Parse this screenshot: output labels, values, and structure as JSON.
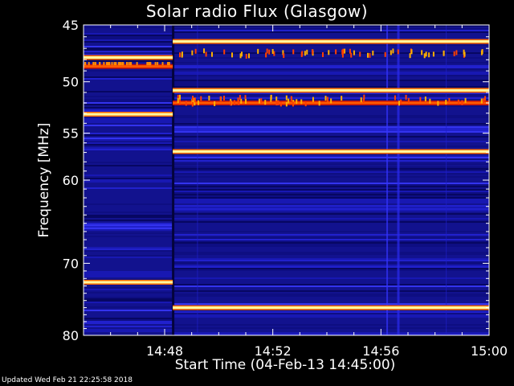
{
  "chart_data": {
    "type": "heatmap",
    "title": "Solar radio Flux (Glasgow)",
    "xlabel": "Start Time (04-Feb-13 14:45:00)",
    "ylabel": "Frequency [MHz]",
    "x_ticks": [
      "14:48",
      "14:52",
      "14:56",
      "15:00"
    ],
    "x_tick_minutes": [
      3,
      7,
      11,
      15
    ],
    "xlim_minutes": [
      0,
      15
    ],
    "y_ticks": [
      45,
      50,
      55,
      60,
      70,
      80
    ],
    "ylim": [
      45,
      80
    ],
    "y_scale": "log",
    "colormap": [
      "#000000",
      "#0a0a8a",
      "#1a1ad0",
      "#3030ff",
      "#ff3000",
      "#ff9000",
      "#ffff80",
      "#ffffff"
    ],
    "features": [
      {
        "kind": "band",
        "freq": 47.8,
        "t_start": 0,
        "t_end": 3.3,
        "intensity": "high"
      },
      {
        "kind": "band",
        "freq": 48.6,
        "t_start": 0,
        "t_end": 3.3,
        "intensity": "medium"
      },
      {
        "kind": "band",
        "freq": 53.1,
        "t_start": 0,
        "t_end": 3.3,
        "intensity": "high"
      },
      {
        "kind": "band",
        "freq": 72.5,
        "t_start": 0,
        "t_end": 3.3,
        "intensity": "high"
      },
      {
        "kind": "band",
        "freq": 46.4,
        "t_start": 3.3,
        "t_end": 15,
        "intensity": "high"
      },
      {
        "kind": "band",
        "freq": 50.8,
        "t_start": 3.3,
        "t_end": 15,
        "intensity": "high"
      },
      {
        "kind": "band",
        "freq": 52.0,
        "t_start": 3.3,
        "t_end": 15,
        "intensity": "medium"
      },
      {
        "kind": "band",
        "freq": 56.9,
        "t_start": 3.3,
        "t_end": 15,
        "intensity": "high"
      },
      {
        "kind": "band",
        "freq": 76.0,
        "t_start": 3.3,
        "t_end": 15,
        "intensity": "high"
      }
    ]
  },
  "footer": "Updated Wed Feb 21 22:25:58 2018"
}
